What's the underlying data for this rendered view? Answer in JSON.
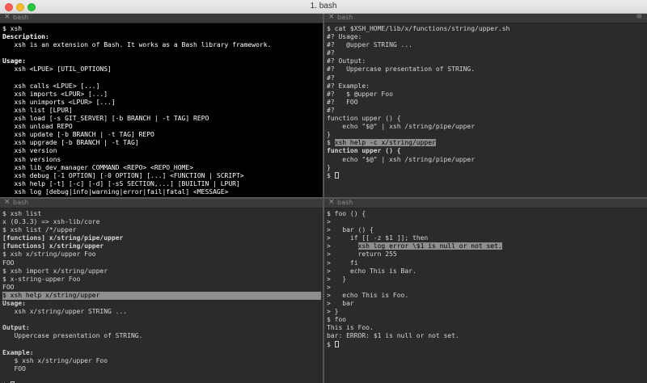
{
  "window": {
    "title": "1. bash"
  },
  "panes": {
    "top_left": {
      "tab": "bash",
      "lines": [
        {
          "t": "$ xsh"
        },
        {
          "t": "Description:",
          "b": true
        },
        {
          "t": "   xsh is an extension of Bash. It works as a Bash library framework."
        },
        {
          "t": ""
        },
        {
          "t": "Usage:",
          "b": true
        },
        {
          "t": "   xsh <LPUE> [UTIL_OPTIONS]"
        },
        {
          "t": ""
        },
        {
          "t": "   xsh calls <LPUE> [...]"
        },
        {
          "t": "   xsh imports <LPUR> [...]"
        },
        {
          "t": "   xsh unimports <LPUR> [...]"
        },
        {
          "t": "   xsh list [LPUR]"
        },
        {
          "t": "   xsh load [-s GIT_SERVER] [-b BRANCH | -t TAG] REPO"
        },
        {
          "t": "   xsh unload REPO"
        },
        {
          "t": "   xsh update [-b BRANCH | -t TAG] REPO"
        },
        {
          "t": "   xsh upgrade [-b BRANCH | -t TAG]"
        },
        {
          "t": "   xsh version"
        },
        {
          "t": "   xsh versions"
        },
        {
          "t": "   xsh lib_dev_manager COMMAND <REPO> <REPO_HOME>"
        },
        {
          "t": "   xsh debug [-1 OPTION] [-0 OPTION] [...] <FUNCTION | SCRIPT>"
        },
        {
          "t": "   xsh help [-t] [-c] [-d] [-sS SECTION,...] [BUILTIN | LPUR]"
        },
        {
          "t": "   xsh log [debug|info|warning|error|fail|fatal] <MESSAGE>"
        }
      ]
    },
    "top_right": {
      "tab": "bash",
      "lines": [
        {
          "t": "$ cat $XSH_HOME/lib/x/functions/string/upper.sh"
        },
        {
          "t": "#? Usage:"
        },
        {
          "t": "#?   @upper STRING ..."
        },
        {
          "t": "#?"
        },
        {
          "t": "#? Output:"
        },
        {
          "t": "#?   Uppercase presentation of STRING."
        },
        {
          "t": "#?"
        },
        {
          "t": "#? Example:"
        },
        {
          "t": "#?   $ @upper Foo"
        },
        {
          "t": "#?   FOO"
        },
        {
          "t": "#?"
        },
        {
          "t": "function upper () {"
        },
        {
          "t": "    echo \"$@\" | xsh /string/pipe/upper"
        },
        {
          "t": "}"
        },
        {
          "t": "$ ",
          "hl": "xsh help -c x/string/upper"
        },
        {
          "t": "function upper () {",
          "b": true
        },
        {
          "t": "    echo \"$@\" | xsh /string/pipe/upper"
        },
        {
          "t": "}"
        },
        {
          "t": "$ ",
          "cursor": true
        }
      ]
    },
    "bottom_left": {
      "tab": "bash",
      "lines": [
        {
          "t": "$ xsh list"
        },
        {
          "t": "x (0.3.3) => xsh-lib/core"
        },
        {
          "t": "$ xsh list /*/upper"
        },
        {
          "t": "[functions] x/string/pipe/upper",
          "b": true
        },
        {
          "t": "[functions] x/string/upper",
          "b": true
        },
        {
          "t": "$ xsh x/string/upper Foo"
        },
        {
          "t": "FOO"
        },
        {
          "t": "$ xsh import x/string/upper"
        },
        {
          "t": "$ x-string-upper Foo"
        },
        {
          "t": "FOO"
        },
        {
          "t": "$ ",
          "hl": "xsh help x/string/upper",
          "hlfull": true
        },
        {
          "t": "Usage:",
          "b": true
        },
        {
          "t": "   xsh x/string/upper STRING ..."
        },
        {
          "t": ""
        },
        {
          "t": "Output:",
          "b": true
        },
        {
          "t": "   Uppercase presentation of STRING."
        },
        {
          "t": ""
        },
        {
          "t": "Example:",
          "b": true
        },
        {
          "t": "   $ xsh x/string/upper Foo"
        },
        {
          "t": "   FOO"
        },
        {
          "t": ""
        },
        {
          "t": "$ ",
          "cursor": true
        }
      ]
    },
    "bottom_right": {
      "tab": "bash",
      "lines": [
        {
          "t": "$ foo () {"
        },
        {
          "t": ">"
        },
        {
          "t": ">   bar () {"
        },
        {
          "t": ">     if [[ -z $1 ]]; then"
        },
        {
          "t": ">       ",
          "hl": "xsh log error \\$1 is null or not set."
        },
        {
          "t": ">       return 255"
        },
        {
          "t": ">     fi"
        },
        {
          "t": ">     echo This is Bar."
        },
        {
          "t": ">   }"
        },
        {
          "t": ">"
        },
        {
          "t": ">   echo This is Foo."
        },
        {
          "t": ">   bar"
        },
        {
          "t": "> }"
        },
        {
          "t": "$ foo"
        },
        {
          "t": "This is Foo."
        },
        {
          "t": "bar: ERROR: $1 is null or not set."
        },
        {
          "t": "$ ",
          "cursor": true
        }
      ]
    }
  },
  "icons": {
    "tab_close": "×",
    "tab_menu": "≡"
  }
}
